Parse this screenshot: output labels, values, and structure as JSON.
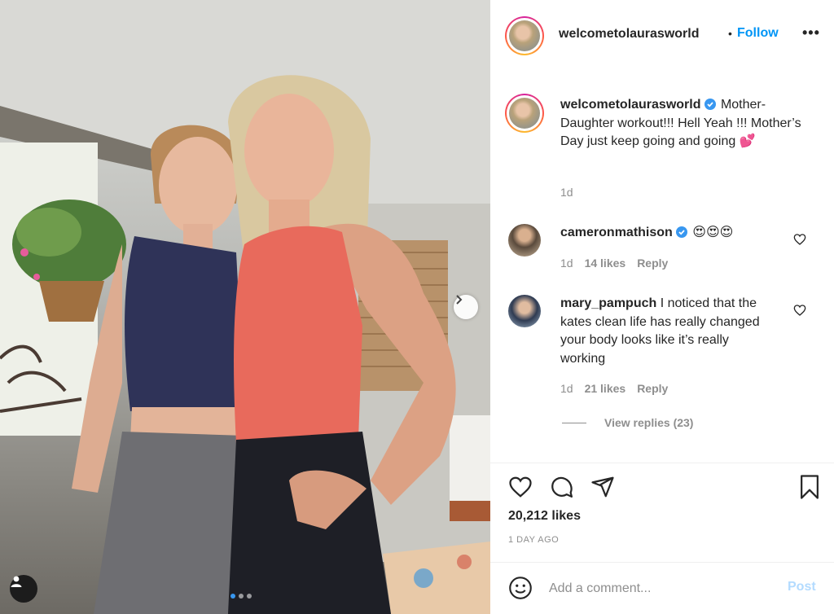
{
  "post": {
    "username": "welcometolaurasworld",
    "separator": "•",
    "follow_label": "Follow",
    "more_label": "•••",
    "caption": {
      "username": "welcometolaurasworld",
      "text": "Mother-Daughter workout!!! Hell Yeah !!! Mother’s Day just keep going and going 💕",
      "time": "1d"
    },
    "likes": "20,212 likes",
    "posted_ago": "1 DAY AGO",
    "carousel": {
      "slides": 3,
      "active_slide": 1
    }
  },
  "comments": [
    {
      "username": "cameronmathison",
      "verified": true,
      "text": "😍😍😍",
      "time": "1d",
      "likes": "14 likes",
      "reply_label": "Reply"
    },
    {
      "username": "mary_pampuch",
      "verified": false,
      "text": "I noticed that the kates clean life has really changed your body looks like it’s really working",
      "time": "1d",
      "likes": "21 likes",
      "reply_label": "Reply",
      "view_replies": "View replies (23)"
    }
  ],
  "composer": {
    "placeholder": "Add a comment...",
    "post_label": "Post"
  },
  "colors": {
    "accent": "#0095f6",
    "verified": "#3897f0",
    "muted": "#8e8e8e",
    "post_disabled": "#b3dbff"
  },
  "icons": [
    "verified-badge-icon",
    "heart-icon",
    "comment-icon",
    "share-icon",
    "bookmark-icon",
    "emoji-icon",
    "user-tag-icon",
    "chevron-right-icon"
  ]
}
